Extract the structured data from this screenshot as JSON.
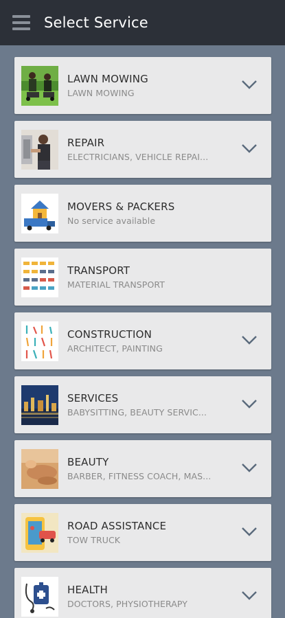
{
  "header": {
    "title": "Select Service"
  },
  "services": [
    {
      "name": "LAWN MOWING",
      "sub": "LAWN MOWING",
      "expandable": true
    },
    {
      "name": "REPAIR",
      "sub": "ELECTRICIANS, VEHICLE REPAI...",
      "expandable": true
    },
    {
      "name": "MOVERS & PACKERS",
      "sub": "No service available",
      "expandable": false
    },
    {
      "name": "TRANSPORT",
      "sub": "MATERIAL TRANSPORT",
      "expandable": false
    },
    {
      "name": "CONSTRUCTION",
      "sub": "ARCHITECT, PAINTING",
      "expandable": true
    },
    {
      "name": "SERVICES",
      "sub": "BABYSITTING, BEAUTY SERVIC...",
      "expandable": true
    },
    {
      "name": "BEAUTY",
      "sub": "BARBER, FITNESS COACH, MAS...",
      "expandable": true
    },
    {
      "name": "ROAD ASSISTANCE",
      "sub": "TOW TRUCK",
      "expandable": true
    },
    {
      "name": "HEALTH",
      "sub": "DOCTORS, PHYSIOTHERAPY",
      "expandable": true
    }
  ],
  "icons": {
    "menu": "hamburger-menu-icon",
    "expand": "chevron-down-icon"
  },
  "colors": {
    "appbar": "#2c3038",
    "background": "#6c7a8c",
    "card": "#e9e9ea",
    "chevron": "#5a6a7c"
  }
}
